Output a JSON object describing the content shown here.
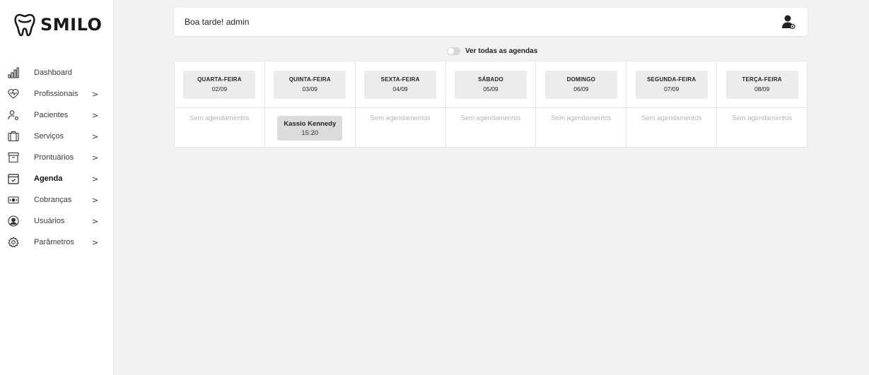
{
  "app": {
    "logo_text": "SMILO"
  },
  "sidebar": {
    "items": [
      {
        "label": "Dashboard",
        "icon": "bar-chart-icon",
        "arrow": ""
      },
      {
        "label": "Profissionais",
        "icon": "heart-pulse-icon",
        "arrow": ">"
      },
      {
        "label": "Pacientes",
        "icon": "user-gear-icon",
        "arrow": ">"
      },
      {
        "label": "Serviços",
        "icon": "briefcase-icon",
        "arrow": ">"
      },
      {
        "label": "Prontuários",
        "icon": "archive-icon",
        "arrow": ">"
      },
      {
        "label": "Agenda",
        "icon": "calendar-check-icon",
        "arrow": ">",
        "active": true
      },
      {
        "label": "Cobranças",
        "icon": "money-icon",
        "arrow": ">"
      },
      {
        "label": "Usuários",
        "icon": "user-circle-icon",
        "arrow": ">"
      },
      {
        "label": "Parâmetros",
        "icon": "gear-icon",
        "arrow": ">"
      }
    ]
  },
  "header": {
    "greeting": "Boa tarde! admin",
    "user_icon": "user-avatar-icon"
  },
  "toggle": {
    "label": "Ver todas as agendas",
    "checked": false
  },
  "schedule": {
    "days": [
      {
        "name": "QUARTA-FEIRA",
        "date": "02/09",
        "empty_text": "Sem agendamentos",
        "appointments": []
      },
      {
        "name": "QUINTA-FEIRA",
        "date": "03/09",
        "empty_text": "",
        "appointments": [
          {
            "patient": "Kassio Kennedy",
            "time": "15:20"
          }
        ]
      },
      {
        "name": "SEXTA-FEIRA",
        "date": "04/09",
        "empty_text": "Sem agendamentos",
        "appointments": []
      },
      {
        "name": "SÁBADO",
        "date": "05/09",
        "empty_text": "Sem agendamentos",
        "appointments": []
      },
      {
        "name": "DOMINGO",
        "date": "06/09",
        "empty_text": "Sem agendamentos",
        "appointments": []
      },
      {
        "name": "SEGUNDA-FEIRA",
        "date": "07/09",
        "empty_text": "Sem agendamentos",
        "appointments": []
      },
      {
        "name": "TERÇA-FEIRA",
        "date": "08/09",
        "empty_text": "Sem agendamentos",
        "appointments": []
      }
    ]
  },
  "colors": {
    "background": "#f2f2f2",
    "card": "#ffffff",
    "day_box": "#ececec",
    "appointment": "#dcdcdc",
    "muted_text": "#b5b5b5"
  }
}
